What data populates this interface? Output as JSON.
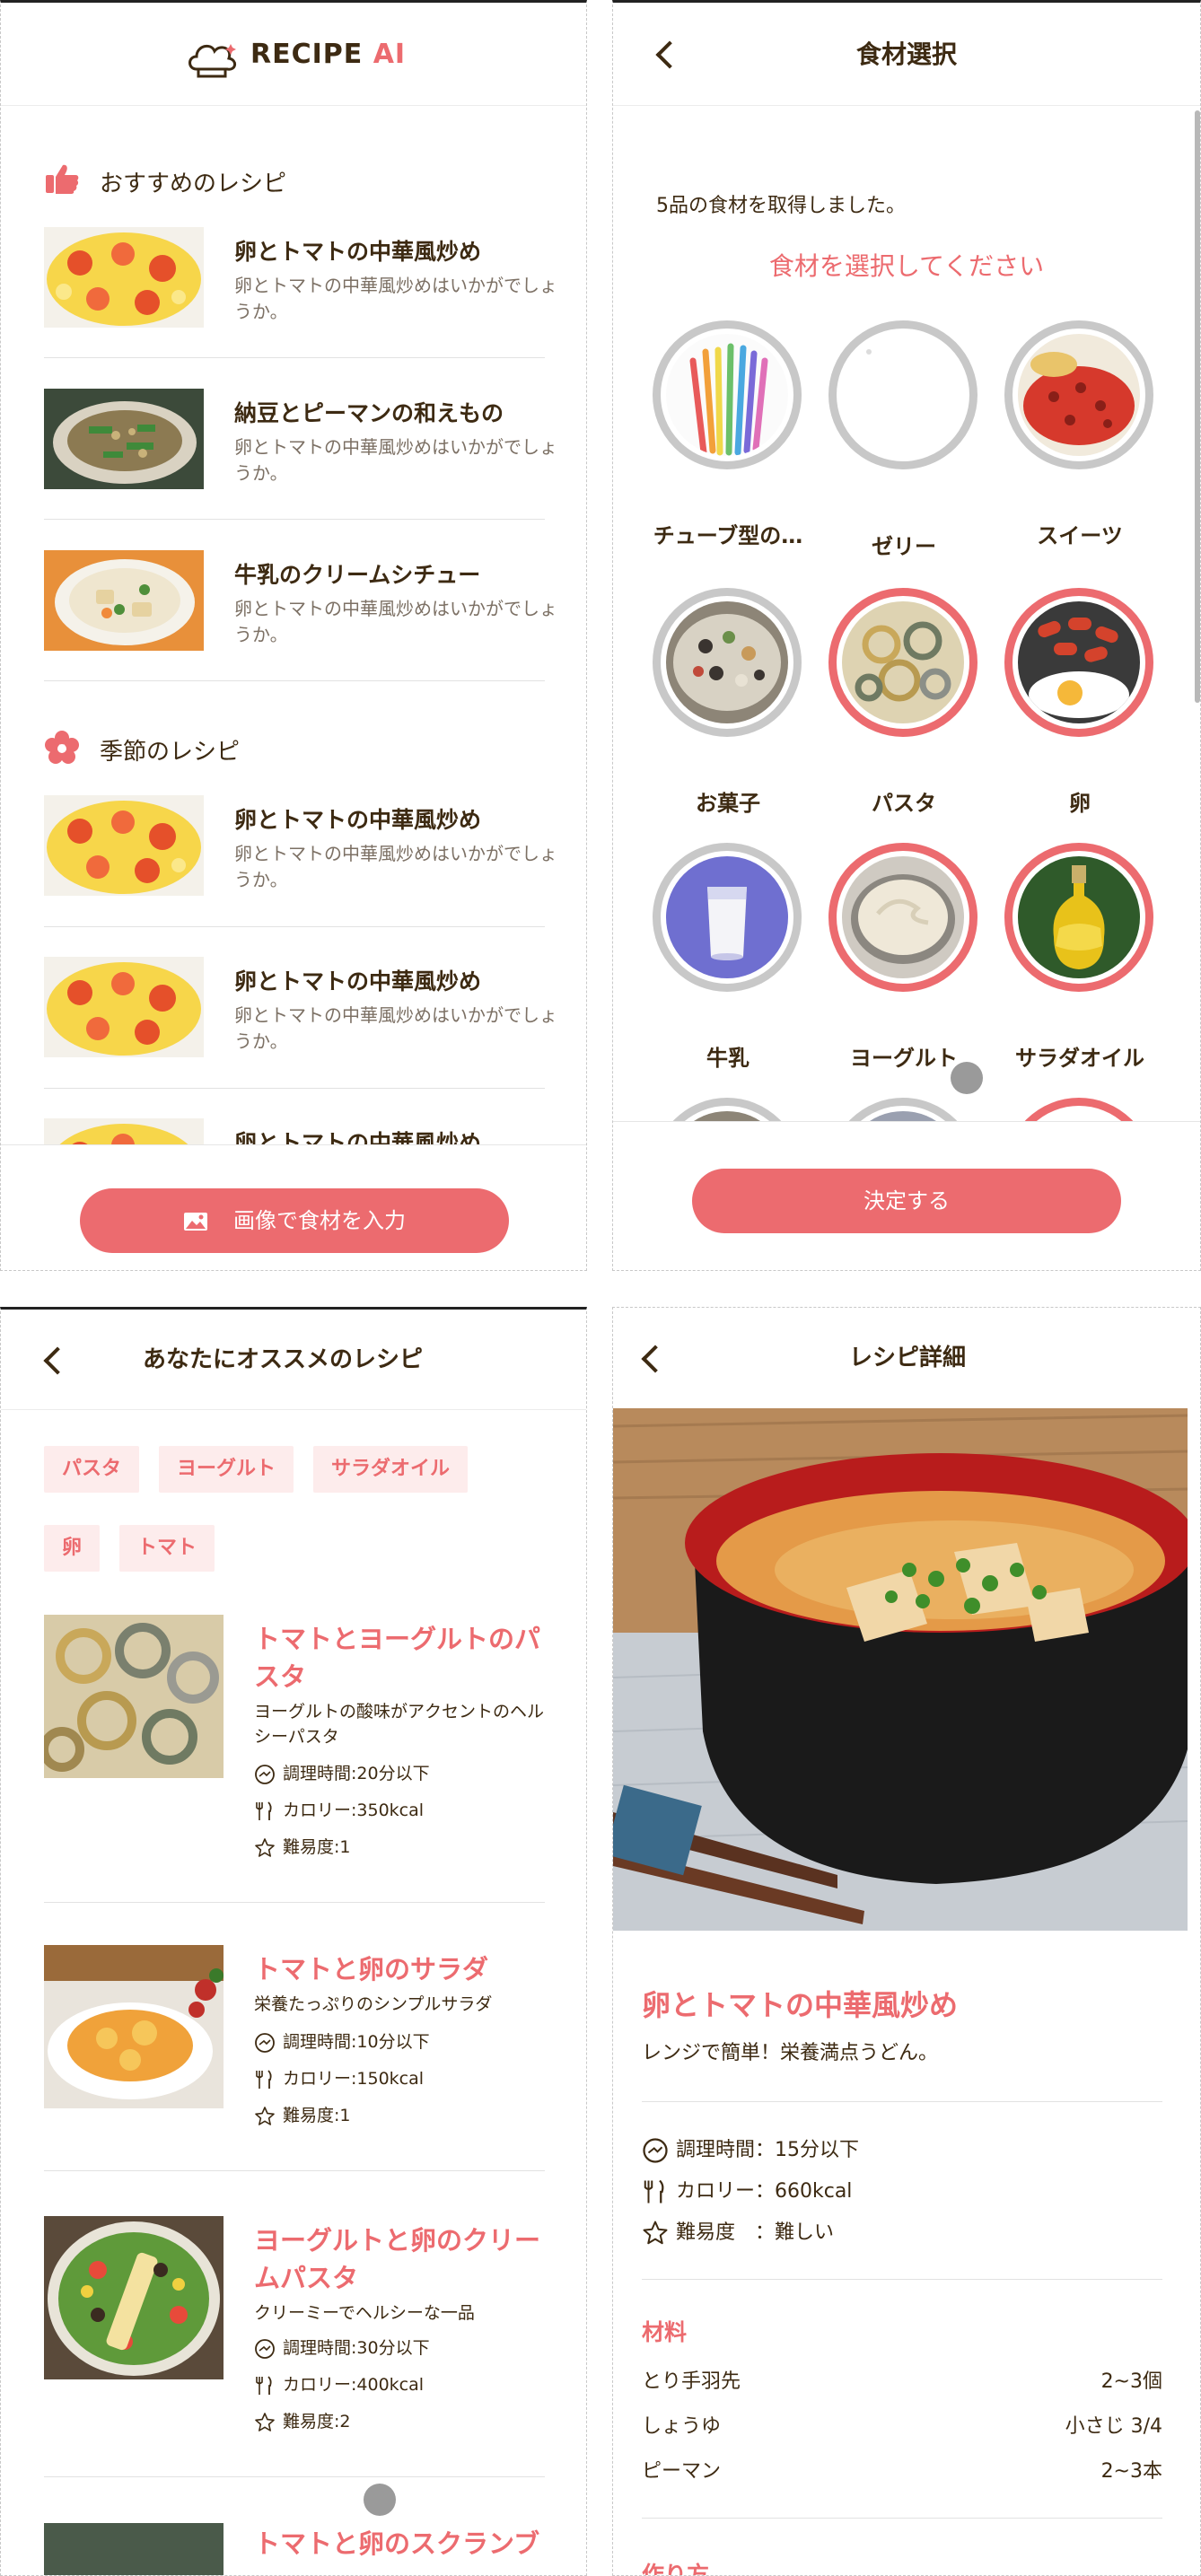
{
  "screen1": {
    "logo_text": "RECIPE",
    "logo_accent": "AI",
    "recommended_title": "おすすめのレシピ",
    "recommended": [
      {
        "title": "卵とトマトの中華風炒め",
        "desc": "卵とトマトの中華風炒めはいかがでしょうか。"
      },
      {
        "title": "納豆とピーマンの和えもの",
        "desc": "卵とトマトの中華風炒めはいかがでしょうか。"
      },
      {
        "title": "牛乳のクリームシチュー",
        "desc": "卵とトマトの中華風炒めはいかがでしょうか。"
      }
    ],
    "seasonal_title": "季節のレシピ",
    "seasonal": [
      {
        "title": "卵とトマトの中華風炒め",
        "desc": "卵とトマトの中華風炒めはいかがでしょうか。"
      },
      {
        "title": "卵とトマトの中華風炒め",
        "desc": "卵とトマトの中華風炒めはいかがでしょうか。"
      },
      {
        "title": "卵とトマトの中華風炒め"
      }
    ],
    "input_button": "画像で食材を入力"
  },
  "screen2": {
    "title": "食材選択",
    "status": "5品の食材を取得しました。",
    "prompt": "食材を選択してください",
    "ingredients": [
      {
        "label": "チューブ型の…",
        "selected": false
      },
      {
        "label": "ゼリー",
        "selected": false
      },
      {
        "label": "スイーツ",
        "selected": false
      },
      {
        "label": "お菓子",
        "selected": false
      },
      {
        "label": "パスタ",
        "selected": true
      },
      {
        "label": "卵",
        "selected": true
      },
      {
        "label": "牛乳",
        "selected": false
      },
      {
        "label": "ヨーグルト",
        "selected": true
      },
      {
        "label": "サラダオイル",
        "selected": true
      }
    ],
    "confirm_button": "決定する"
  },
  "screen3": {
    "title": "あなたにオススメのレシピ",
    "chips": [
      "パスタ",
      "ヨーグルト",
      "サラダオイル",
      "卵",
      "トマト"
    ],
    "recipes": [
      {
        "title": "トマトとヨーグルトのパスタ",
        "desc": "ヨーグルトの酸味がアクセントのヘルシーパスタ",
        "time": "調理時間:20分以下",
        "calories": "カロリー:350kcal",
        "difficulty": "難易度:1"
      },
      {
        "title": "トマトと卵のサラダ",
        "desc": "栄養たっぷりのシンプルサラダ",
        "time": "調理時間:10分以下",
        "calories": "カロリー:150kcal",
        "difficulty": "難易度:1"
      },
      {
        "title": "ヨーグルトと卵のクリームパスタ",
        "desc": "クリーミーでヘルシーな一品",
        "time": "調理時間:30分以下",
        "calories": "カロリー:400kcal",
        "difficulty": "難易度:2"
      },
      {
        "title": "トマトと卵のスクランブ"
      }
    ]
  },
  "screen4": {
    "title": "レシピ詳細",
    "recipe_title": "卵とトマトの中華風炒め",
    "subtitle": "レンジで簡単！栄養満点うどん。",
    "time": "調理時間：15分以下",
    "calories": "カロリー：660kcal",
    "difficulty": "難易度　：難しい",
    "ingredients_title": "材料",
    "ingredients": [
      {
        "name": "とり手羽先",
        "amount": "2~3個"
      },
      {
        "name": "しょうゆ",
        "amount": "小さじ 3/4"
      },
      {
        "name": "ピーマン",
        "amount": "2~3本"
      }
    ],
    "steps_title": "作り方"
  },
  "colors": {
    "accent": "#ec6b6f",
    "text": "#3d2a12",
    "muted": "#7c7064"
  }
}
